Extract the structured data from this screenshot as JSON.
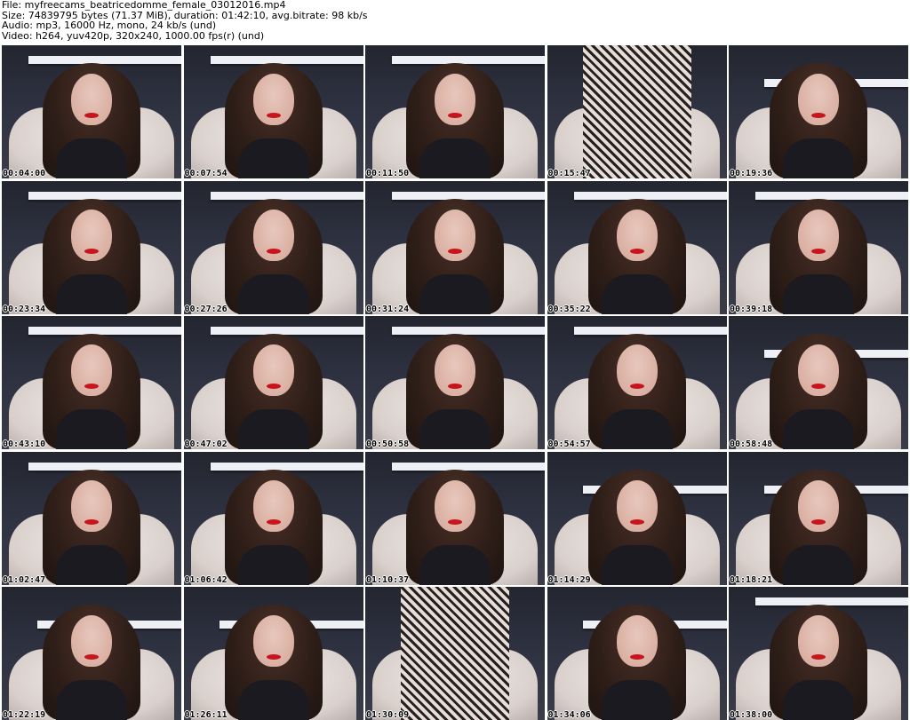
{
  "header": {
    "file_line": "File: myfreecams_beatricedomme_female_03012016.mp4",
    "size_line": "Size: 74839795 bytes (71.37 MiB), duration: 01:42:10, avg.bitrate: 98 kb/s",
    "audio_line": "Audio: mp3, 16000 Hz, mono, 24 kb/s (und)",
    "video_line": "Video: h264, yuv420p, 320x240, 1000.00 fps(r) (und)"
  },
  "frames": [
    {
      "timestamp": "00:04:00",
      "variant": "a"
    },
    {
      "timestamp": "00:07:54",
      "variant": "a"
    },
    {
      "timestamp": "00:11:50",
      "variant": "a"
    },
    {
      "timestamp": "00:15:47",
      "variant": "c"
    },
    {
      "timestamp": "00:19:36",
      "variant": "b"
    },
    {
      "timestamp": "00:23:34",
      "variant": "a"
    },
    {
      "timestamp": "00:27:26",
      "variant": "a"
    },
    {
      "timestamp": "00:31:24",
      "variant": "a"
    },
    {
      "timestamp": "00:35:22",
      "variant": "a"
    },
    {
      "timestamp": "00:39:18",
      "variant": "a"
    },
    {
      "timestamp": "00:43:10",
      "variant": "a"
    },
    {
      "timestamp": "00:47:02",
      "variant": "a"
    },
    {
      "timestamp": "00:50:58",
      "variant": "a"
    },
    {
      "timestamp": "00:54:57",
      "variant": "a"
    },
    {
      "timestamp": "00:58:48",
      "variant": "b"
    },
    {
      "timestamp": "01:02:47",
      "variant": "a"
    },
    {
      "timestamp": "01:06:42",
      "variant": "a"
    },
    {
      "timestamp": "01:10:37",
      "variant": "a"
    },
    {
      "timestamp": "01:14:29",
      "variant": "b"
    },
    {
      "timestamp": "01:18:21",
      "variant": "b"
    },
    {
      "timestamp": "01:22:19",
      "variant": "b"
    },
    {
      "timestamp": "01:26:11",
      "variant": "b"
    },
    {
      "timestamp": "01:30:09",
      "variant": "c"
    },
    {
      "timestamp": "01:34:06",
      "variant": "b"
    },
    {
      "timestamp": "01:38:00",
      "variant": "a"
    }
  ],
  "colors": {
    "background": "#ffffff",
    "text": "#000000",
    "lipstick": "#c8141c"
  }
}
